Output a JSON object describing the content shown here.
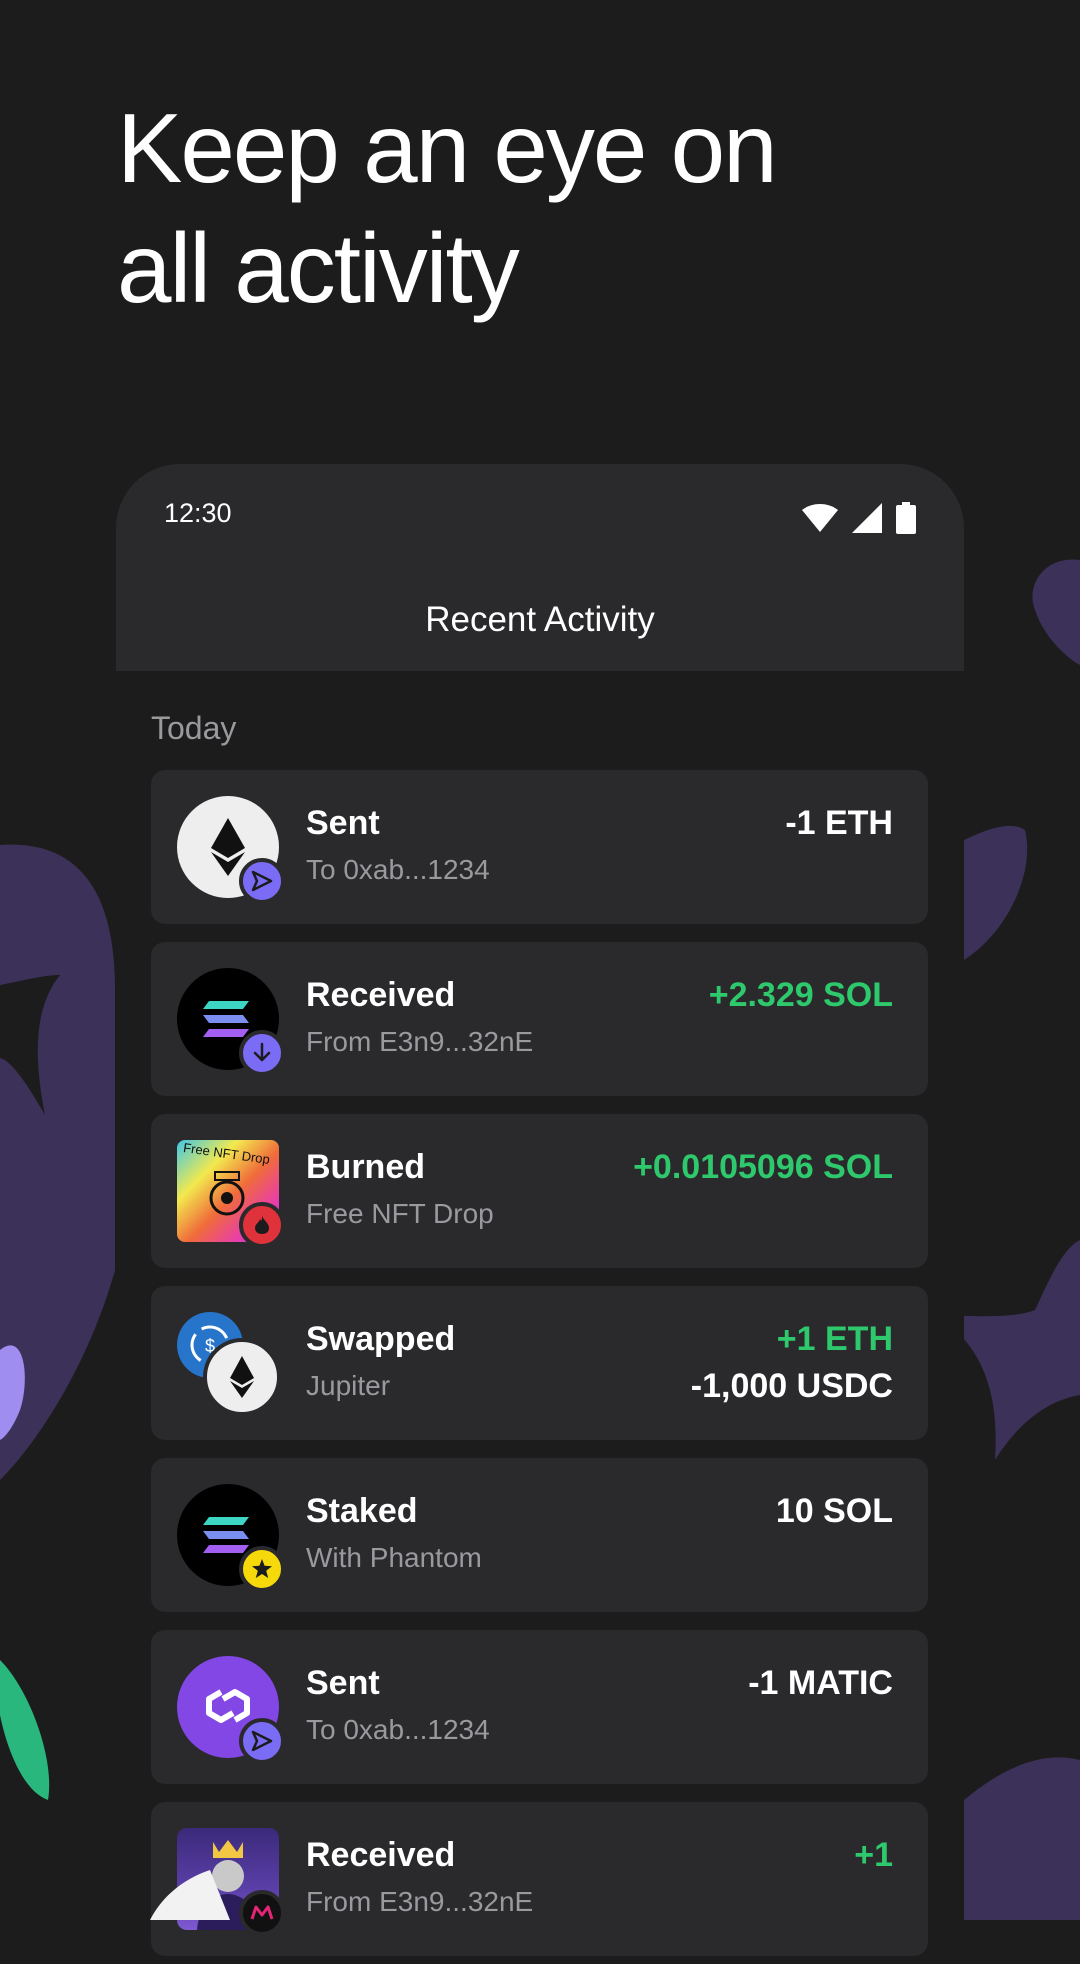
{
  "headline": {
    "line1": "Keep an eye on",
    "line2": "all activity"
  },
  "status_bar": {
    "time": "12:30",
    "icons": [
      "wifi-icon",
      "signal-icon",
      "battery-icon"
    ]
  },
  "screen": {
    "title": "Recent Activity",
    "section": "Today"
  },
  "colors": {
    "background": "#1c1c1d",
    "card": "#2a2a2c",
    "positive": "#2ec96c",
    "muted": "#9a9a9e",
    "accent_purple": "#7b6cf6",
    "shape_purple": "#3c3159"
  },
  "activities": [
    {
      "title": "Sent",
      "subtitle": "To 0xab...1234",
      "amount": "-1 ETH",
      "tone": "neutral",
      "icon": "ethereum-icon",
      "badge": "send-icon"
    },
    {
      "title": "Received",
      "subtitle": "From E3n9...32nE",
      "amount": "+2.329 SOL",
      "tone": "positive",
      "icon": "solana-icon",
      "badge": "receive-icon"
    },
    {
      "title": "Burned",
      "subtitle": "Free NFT Drop",
      "amount": "+0.0105096 SOL",
      "tone": "positive",
      "icon": "nft-image-icon",
      "badge": "fire-icon",
      "nft_text": "Free NFT Drop"
    },
    {
      "title": "Swapped",
      "subtitle": "Jupiter",
      "amount": "+1 ETH",
      "amount2": "-1,000 USDC",
      "tone": "positive",
      "icon": "usdc-ethereum-icon",
      "badge": ""
    },
    {
      "title": "Staked",
      "subtitle": "With Phantom",
      "amount": "10 SOL",
      "tone": "neutral",
      "icon": "solana-icon",
      "badge": "star-icon"
    },
    {
      "title": "Sent",
      "subtitle": "To 0xab...1234",
      "amount": "-1 MATIC",
      "tone": "neutral",
      "icon": "polygon-icon",
      "badge": "send-icon"
    },
    {
      "title": "Received",
      "subtitle": "From E3n9...32nE",
      "amount": "+1",
      "tone": "positive",
      "icon": "nft-avatar-icon",
      "badge": "magic-eden-icon"
    }
  ]
}
